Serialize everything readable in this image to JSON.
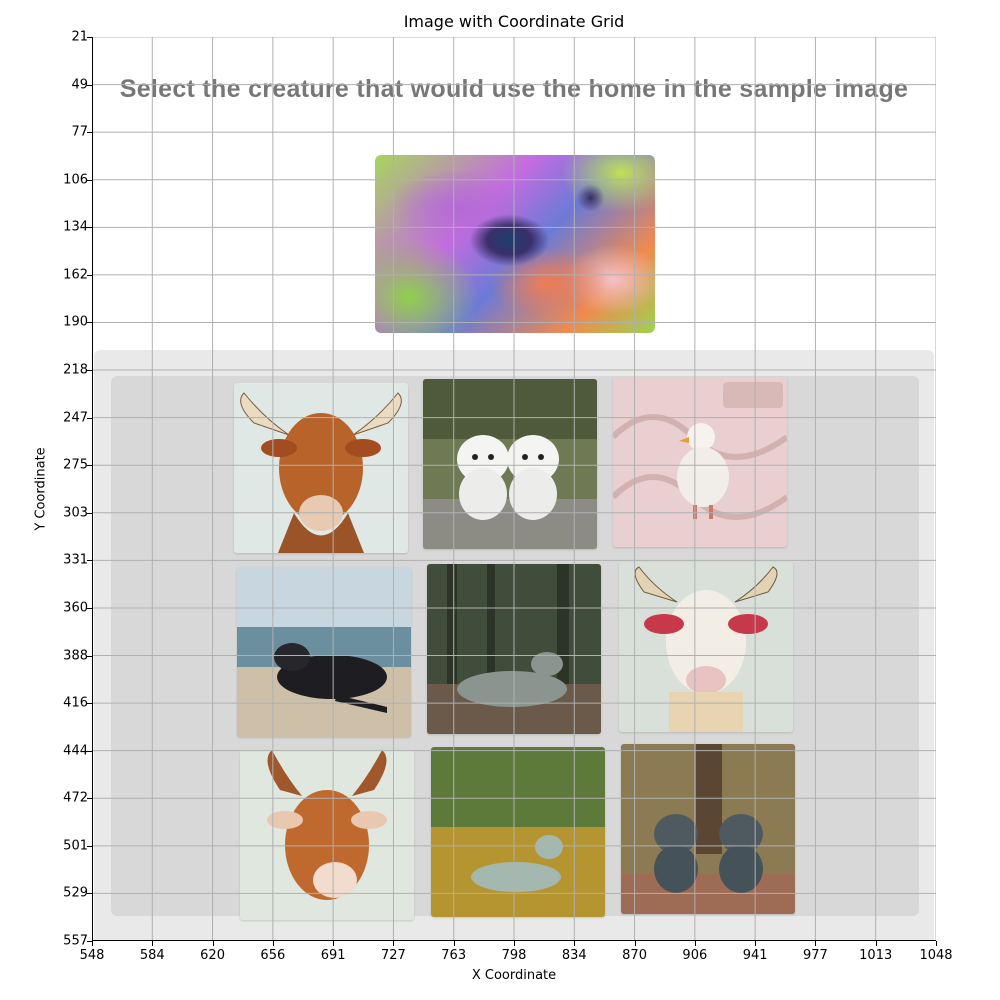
{
  "figure": {
    "title": "Image with Coordinate Grid",
    "xlabel": "X Coordinate",
    "ylabel": "Y Coordinate",
    "x_ticks": [
      "548",
      "584",
      "620",
      "656",
      "691",
      "727",
      "763",
      "798",
      "834",
      "870",
      "906",
      "941",
      "977",
      "1013",
      "1048"
    ],
    "y_ticks": [
      "21",
      "49",
      "77",
      "106",
      "134",
      "162",
      "190",
      "218",
      "247",
      "275",
      "303",
      "331",
      "360",
      "388",
      "416",
      "444",
      "472",
      "501",
      "529",
      "557"
    ],
    "grid": true
  },
  "captcha": {
    "prompt": "Select the creature that would use the home in the sample image",
    "sample_image": "colorful-bird-nest-image",
    "choices": [
      {
        "subject": "horned-cow-portrait"
      },
      {
        "subject": "two-white-puppies"
      },
      {
        "subject": "white-duck-on-patterned-background"
      },
      {
        "subject": "black-cow-lying-on-beach"
      },
      {
        "subject": "cow-lying-in-forest"
      },
      {
        "subject": "white-cow-with-horns"
      },
      {
        "subject": "brown-cow-with-horns"
      },
      {
        "subject": "calf-lying-in-grass"
      },
      {
        "subject": "two-gray-puppies"
      }
    ]
  },
  "colors": {
    "grid": "#b0b0b0",
    "panel": "#e9e9e9",
    "panel_inner": "#d8d8d8",
    "prompt": "#777777"
  }
}
